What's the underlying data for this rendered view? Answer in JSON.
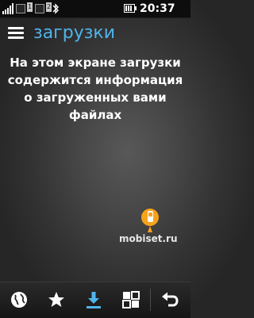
{
  "status_bar": {
    "sim1_number": "1",
    "sim2_number": "2",
    "time": "20:37",
    "icons": [
      "signal-icon",
      "sim-icon",
      "bluetooth-icon",
      "battery-icon"
    ]
  },
  "header": {
    "title": "загрузки",
    "menu_icon": "hamburger-menu-icon"
  },
  "content": {
    "message": "На этом экране загрузки содержится информация о загруженных вами файлах"
  },
  "watermark": {
    "text": "mobiset.ru"
  },
  "toolbar": {
    "buttons": [
      {
        "icon": "globe-icon"
      },
      {
        "icon": "star-icon"
      },
      {
        "icon": "download-icon",
        "active": true
      },
      {
        "icon": "grid-icon"
      },
      {
        "icon": "back-icon"
      }
    ]
  },
  "colors": {
    "accent": "#4fb4ec",
    "active_icon": "#4fb4ec",
    "text": "#ffffff"
  }
}
